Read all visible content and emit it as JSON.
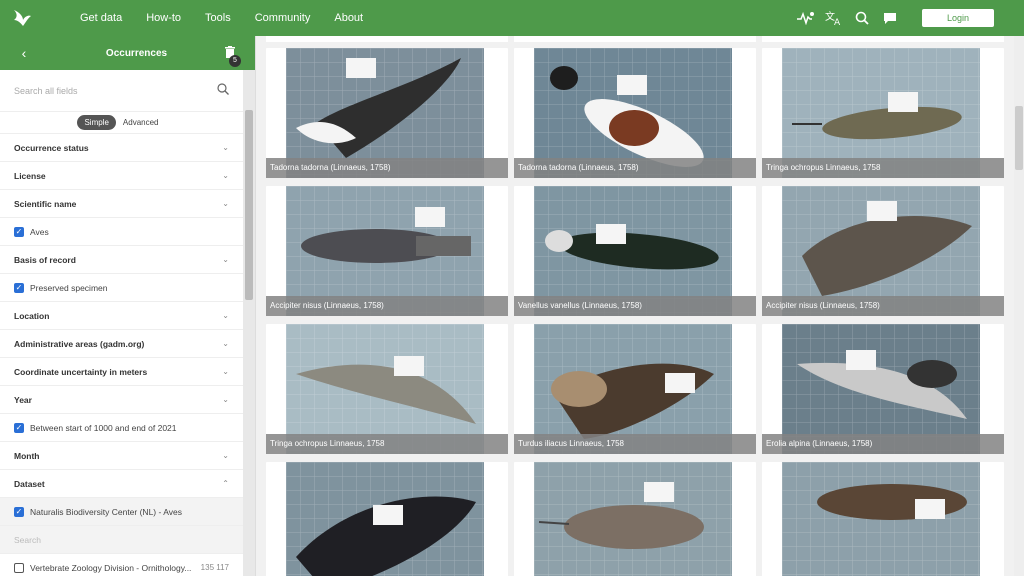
{
  "nav": {
    "items": [
      "Get data",
      "How-to",
      "Tools",
      "Community",
      "About"
    ],
    "login_label": "Login"
  },
  "sidebar": {
    "back_glyph": "‹",
    "title": "Occurrences",
    "badge_count": "5",
    "search_placeholder": "Search all fields",
    "mode_simple": "Simple",
    "mode_advanced": "Advanced",
    "filters": {
      "occurrence_status": "Occurrence status",
      "license": "License",
      "scientific_name": "Scientific name",
      "scientific_name_value": "Aves",
      "basis_of_record": "Basis of record",
      "basis_of_record_value": "Preserved specimen",
      "location": "Location",
      "admin_areas": "Administrative areas (gadm.org)",
      "coord_uncertainty": "Coordinate uncertainty in meters",
      "year": "Year",
      "year_value": "Between start of 1000 and end of 2021",
      "month": "Month",
      "dataset": "Dataset",
      "dataset_selected": "Naturalis Biodiversity Center (NL) - Aves",
      "dataset_search": "Search",
      "dataset_option": "Vertebrate Zoology Division - Ornithology...",
      "dataset_option_count": "135 117"
    }
  },
  "gallery": {
    "tiles": [
      {
        "caption": "Tadorna tadorna (Linnaeus, 1758)",
        "bg": "#7d8f9b",
        "bird": "#2e2e2e"
      },
      {
        "caption": "Tadorna tadorna (Linnaeus, 1758)",
        "bg": "#6f8796",
        "bird": "#7a3a22"
      },
      {
        "caption": "Tringa ochropus Linnaeus, 1758",
        "bg": "#9fb2bc",
        "bird": "#6f6a52"
      },
      {
        "caption": "Accipiter nisus (Linnaeus, 1758)",
        "bg": "#8fa3ae",
        "bird": "#4d4d52"
      },
      {
        "caption": "Vanellus vanellus (Linnaeus, 1758)",
        "bg": "#7f96a2",
        "bird": "#1e2b22"
      },
      {
        "caption": "Accipiter nisus (Linnaeus, 1758)",
        "bg": "#93a6b0",
        "bird": "#5d554c"
      },
      {
        "caption": "Tringa ochropus Linnaeus, 1758",
        "bg": "#a9bcc4",
        "bird": "#8c8a80"
      },
      {
        "caption": "Turdus iliacus Linnaeus, 1758",
        "bg": "#8aa0ab",
        "bird": "#4b3b2e"
      },
      {
        "caption": "Erolia alpina (Linnaeus, 1758)",
        "bg": "#6b7f8b",
        "bird": "#c9c9c9"
      },
      {
        "caption": "",
        "bg": "#7f939e",
        "bird": "#1f1f24"
      },
      {
        "caption": "",
        "bg": "#8ea1aa",
        "bird": "#7c6f64"
      },
      {
        "caption": "",
        "bg": "#8da0aa",
        "bird": "#5a4636"
      }
    ]
  },
  "colors": {
    "brand": "#4e9a4a",
    "checkbox": "#2a6fd6"
  }
}
